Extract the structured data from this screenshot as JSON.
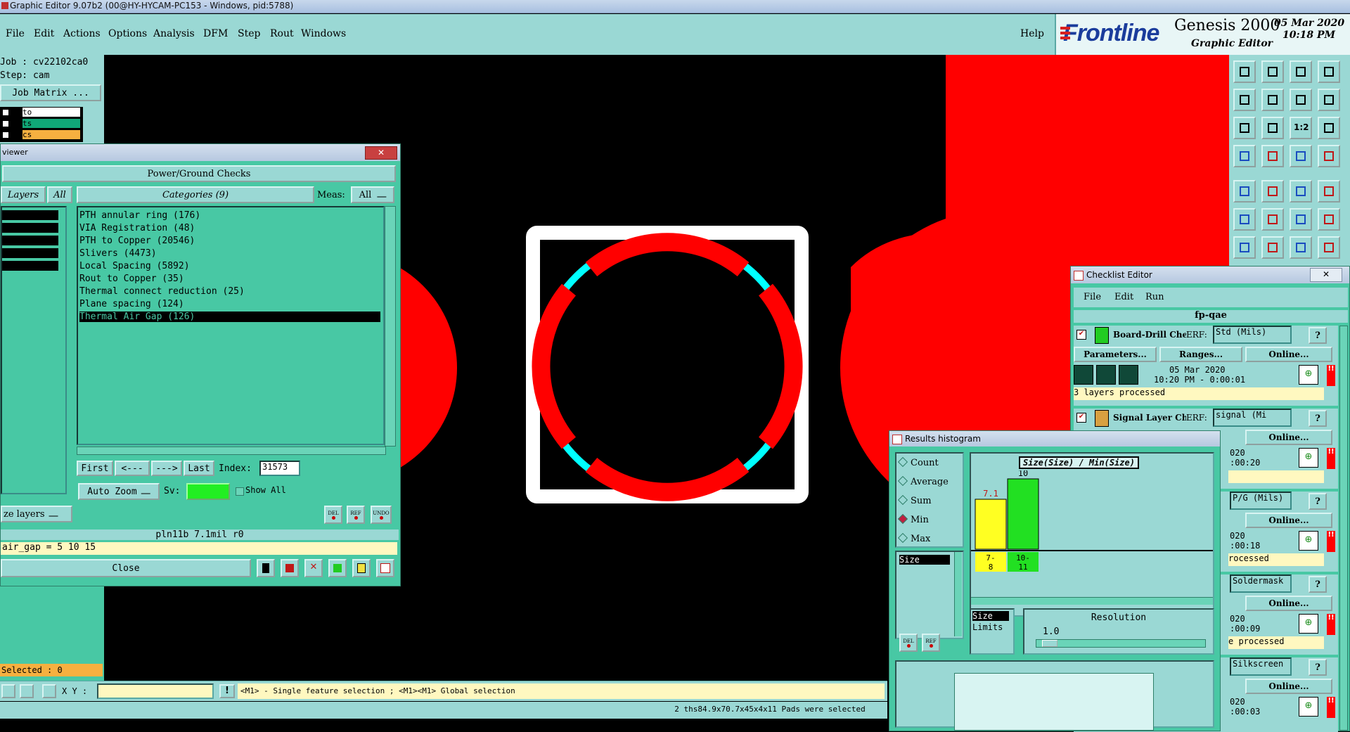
{
  "window_title": "Graphic Editor 9.07b2 (00@HY-HYCAM-PC153 - Windows, pid:5788)",
  "menu": [
    "File",
    "Edit",
    "Actions",
    "Options",
    "Analysis",
    "DFM",
    "Step",
    "Rout",
    "Windows"
  ],
  "help_label": "Help",
  "brand": {
    "logo": "Frontline",
    "product": "Genesis 2000",
    "subtitle": "Graphic Editor",
    "date": "05 Mar 2020",
    "time": "10:18 PM"
  },
  "left_panel": {
    "job": "Job : cv22102ca0",
    "step": "Step: cam",
    "job_matrix": "Job Matrix ...",
    "layers": [
      {
        "name": "to",
        "color": "#ffffff"
      },
      {
        "name": "ts",
        "color": "#10a878"
      },
      {
        "name": "cs",
        "color": "#f6b040"
      }
    ],
    "selected": "Selected : 0"
  },
  "bottom_bar": {
    "xy_label": "X Y :",
    "xy_value": "",
    "hint": "<M1> - Single feature selection ; <M1><M1> Global selection",
    "status": "2 ths84.9x70.7x45x4x11 Pads were selected"
  },
  "viewer": {
    "title": "viewer",
    "section": "Power/Ground Checks",
    "layers_label": "Layers",
    "all_label": "All",
    "categories_header": "Categories (9)",
    "meas_label": "Meas:",
    "meas_value": "All",
    "categories": [
      "PTH annular ring (176)",
      "VIA Registration (48)",
      "PTH to Copper (20546)",
      "Slivers (4473)",
      "Local Spacing (5892)",
      "Rout to Copper (35)",
      "Thermal connect reduction (25)",
      "Plane spacing (124)",
      "Thermal Air Gap (126)"
    ],
    "selected_index": 8,
    "nav": {
      "first": "First",
      "prev": "<---",
      "next": "--->",
      "last": "Last",
      "index_label": "Index:",
      "index_value": "31573"
    },
    "auto_zoom": "Auto Zoom",
    "sv_label": "Sv:",
    "show_all": "Show All",
    "mini_buttons": [
      "DEL",
      "REF",
      "UNDO"
    ],
    "layers_btn": "ze layers",
    "info": "pln11b 7.1mil  r0",
    "formula": "air_gap = 5 10 15",
    "close": "Close"
  },
  "toolbox_icons": [
    "zoom-home",
    "zoom-out",
    "home",
    "grid-toggle",
    "pan-left",
    "pan-right",
    "fit",
    "snap",
    "zoom-fit",
    "zoom-in",
    "ratio-1-2",
    "help",
    "measure",
    "grid",
    "move-layer",
    "snap-layer",
    "add-pad",
    "draw-outline",
    "line",
    "pad",
    "connect",
    "cross",
    "point",
    "arc",
    "slash-red",
    "slash-blue",
    "rotate",
    "mirror"
  ],
  "toolbox_ratio_label": "1:2",
  "checklist": {
    "title": "Checklist Editor",
    "menu": [
      "File",
      "Edit",
      "Run"
    ],
    "name": "fp-qae",
    "rows": [
      {
        "name": "Board-Drill Che",
        "erf": "ERF:",
        "mode": "Std (Mils)",
        "params": "Parameters...",
        "ranges": "Ranges...",
        "online": "Online...",
        "date": "05 Mar 2020",
        "time": "10:20 PM - 0:00:01",
        "status": "3 layers processed",
        "icon_color": "#22cc22"
      },
      {
        "name": "Signal Layer Ch",
        "erf": "ERF:",
        "mode": "signal (Mi",
        "online": "Online...",
        "date": "020",
        "time": ":00:20",
        "status": "",
        "icon_color": "#d8a040"
      },
      {
        "mode": "P/G (Mils)",
        "online": "Online...",
        "date": "020",
        "time": ":00:18",
        "status": "rocessed"
      },
      {
        "mode": "Soldermask",
        "online": "Online...",
        "date": "020",
        "time": ":00:09",
        "status": "e processed"
      },
      {
        "mode": "Silkscreen",
        "online": "Online...",
        "date": "020",
        "time": ":00:03",
        "status": ""
      }
    ]
  },
  "histogram": {
    "title": "Results histogram",
    "options": [
      "Count",
      "Average",
      "Sum",
      "Min",
      "Max"
    ],
    "selected_option": "Min",
    "field": "Size",
    "chart_title": "Size(Size) / Min(Size)",
    "bars": [
      {
        "label": "7.1",
        "value": 7.1,
        "range": "7-\n8",
        "color": "#ffff22"
      },
      {
        "label": "10",
        "value": 10,
        "range": "10-\n11",
        "color": "#22e022"
      }
    ],
    "bottom_list": [
      "Size",
      "Limits"
    ],
    "resolution_label": "Resolution",
    "resolution_value": "1.0",
    "mini_buttons": [
      "DEL",
      "REF"
    ]
  }
}
